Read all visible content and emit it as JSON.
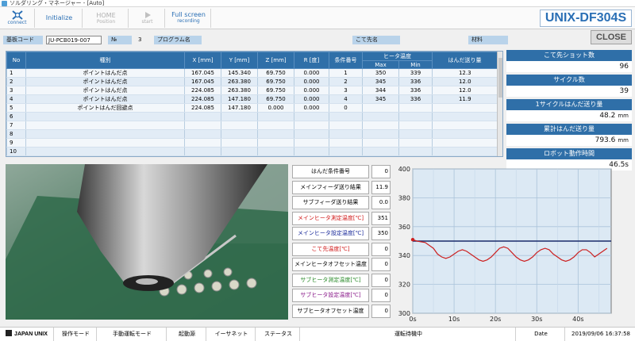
{
  "window": {
    "title": "ソルダリング・マネージャー - [Auto]"
  },
  "toolbar": {
    "connect_label": "connect",
    "initialize_label": "Initialize",
    "home_label": "HOME",
    "home_sub": "Position",
    "start_label": "start",
    "fullscreen_label": "Full screen",
    "fullscreen_sub": "recording",
    "brand": "UNIX-DF304S",
    "close_label": "CLOSE"
  },
  "infobar": {
    "board_code_label": "基板コード",
    "board_code_value": "JU-PCB019-007",
    "no_label": "№",
    "no_value": "3",
    "program_label": "プログラム名",
    "tip_label": "こて先名",
    "material_label": "材料"
  },
  "table": {
    "headers": [
      "No",
      "種別",
      "X [mm]",
      "Y [mm]",
      "Z [mm]",
      "R [度]",
      "条件番号",
      "ヒータ温度",
      "はんだ送り量"
    ],
    "heater_sub": [
      "Max",
      "Min"
    ],
    "rows": [
      [
        "1",
        "ポイントはんだ点",
        "167.045",
        "145.340",
        "69.750",
        "0.000",
        "1",
        "350",
        "339",
        "12.3"
      ],
      [
        "2",
        "ポイントはんだ点",
        "167.045",
        "263.380",
        "69.750",
        "0.000",
        "2",
        "345",
        "336",
        "12.0"
      ],
      [
        "3",
        "ポイントはんだ点",
        "224.085",
        "263.380",
        "69.750",
        "0.000",
        "3",
        "344",
        "336",
        "12.0"
      ],
      [
        "4",
        "ポイントはんだ点",
        "224.085",
        "147.180",
        "69.750",
        "0.000",
        "4",
        "345",
        "336",
        "11.9"
      ],
      [
        "5",
        "ポイントはんだ回避点",
        "224.085",
        "147.180",
        "0.000",
        "0.000",
        "0",
        "",
        "",
        ""
      ],
      [
        "6",
        "",
        "",
        "",
        "",
        "",
        "",
        "",
        "",
        ""
      ],
      [
        "7",
        "",
        "",
        "",
        "",
        "",
        "",
        "",
        "",
        ""
      ],
      [
        "8",
        "",
        "",
        "",
        "",
        "",
        "",
        "",
        "",
        ""
      ],
      [
        "9",
        "",
        "",
        "",
        "",
        "",
        "",
        "",
        "",
        ""
      ],
      [
        "10",
        "",
        "",
        "",
        "",
        "",
        "",
        "",
        "",
        ""
      ]
    ]
  },
  "stats": [
    {
      "label": "こて先ショット数",
      "value": "96",
      "unit": ""
    },
    {
      "label": "サイクル数",
      "value": "39",
      "unit": ""
    },
    {
      "label": "1サイクルはんだ送り量",
      "value": "48.2",
      "unit": "mm"
    },
    {
      "label": "累計はんだ送り量",
      "value": "793.6",
      "unit": "mm"
    },
    {
      "label": "ロボット動作時間",
      "value": "46.5s",
      "unit": ""
    }
  ],
  "params": [
    {
      "label": "はんだ条件番号",
      "value": "0",
      "color": "#000000"
    },
    {
      "label": "メインフィーダ送り結果",
      "value": "11.9",
      "color": "#000000"
    },
    {
      "label": "サブフィーダ送り結果",
      "value": "0.0",
      "color": "#000000"
    },
    {
      "label": "メインヒータ測定温度[℃]",
      "value": "351",
      "color": "#d01818"
    },
    {
      "label": "メインヒータ設定温度[℃]",
      "value": "350",
      "color": "#1a2a9a"
    },
    {
      "label": "こて先温度[℃]",
      "value": "0",
      "color": "#d01818"
    },
    {
      "label": "メインヒータオフセット温度",
      "value": "0",
      "color": "#000000"
    },
    {
      "label": "サブヒータ測定温度[℃]",
      "value": "0",
      "color": "#2a8a2a"
    },
    {
      "label": "サブヒータ設定温度[℃]",
      "value": "0",
      "color": "#8a1a8a"
    },
    {
      "label": "サブヒータオフセット温度",
      "value": "0",
      "color": "#000000"
    }
  ],
  "chart_data": {
    "type": "line",
    "ylim": [
      300,
      400
    ],
    "yticks": [
      "400",
      "380",
      "360",
      "340",
      "320",
      "300"
    ],
    "xlim": [
      0,
      48
    ],
    "xticks": [
      "0s",
      "10s",
      "20s",
      "30s",
      "40s"
    ],
    "grid": true,
    "series": [
      {
        "color": "#1a2a6a",
        "x": [
          0,
          48
        ],
        "y": [
          350,
          350
        ]
      },
      {
        "color": "#cc2020",
        "x": [
          0,
          1,
          3,
          5,
          6,
          7,
          8,
          9,
          10,
          11,
          12,
          13,
          14,
          15,
          16,
          17,
          18,
          19,
          20,
          21,
          22,
          23,
          24,
          25,
          26,
          27,
          28,
          29,
          30,
          31,
          32,
          33,
          34,
          35,
          36,
          37,
          38,
          39,
          40,
          41,
          42,
          43,
          44,
          45,
          46,
          47
        ],
        "y": [
          351,
          350,
          349,
          345,
          341,
          339,
          338,
          339,
          341,
          343,
          344,
          343,
          341,
          339,
          337,
          336,
          337,
          339,
          342,
          345,
          346,
          345,
          342,
          339,
          337,
          336,
          337,
          339,
          342,
          344,
          345,
          344,
          341,
          339,
          337,
          336,
          337,
          339,
          342,
          344,
          344,
          342,
          339,
          341,
          343,
          345
        ]
      }
    ]
  },
  "statusbar": {
    "logo": "JAPAN UNIX",
    "operation_mode": "操作モード",
    "manual_mode": "手動運転モード",
    "origin": "起動源",
    "ethernet": "イーサネット",
    "status": "ステータス",
    "state": "運転待機中",
    "date_label": "Date",
    "datetime": "2019/09/06 16:37:58"
  }
}
